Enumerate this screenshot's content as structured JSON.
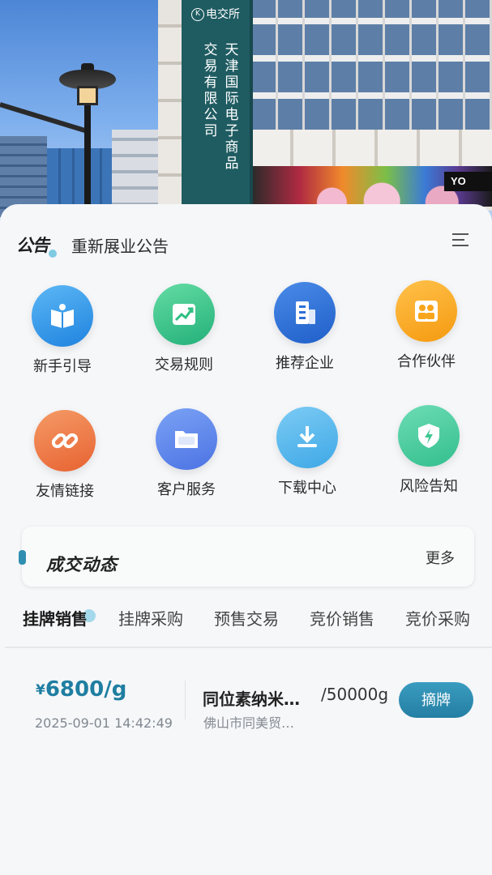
{
  "hero": {
    "sign_logo": "电交所",
    "sign_logo_mark": "K",
    "sign_col_1": "天津国际电子商品",
    "sign_col_2": "交易有限公司",
    "store_badge": "YO"
  },
  "notice": {
    "tag": "公告",
    "text": "重新展业公告",
    "menu_icon": "menu-icon"
  },
  "grid": [
    {
      "label": "新手引导",
      "icon": "book-icon",
      "color": "#2b8fe6"
    },
    {
      "label": "交易规则",
      "icon": "trend-chart-icon",
      "color": "#2fbf82"
    },
    {
      "label": "推荐企业",
      "icon": "building-icon",
      "color": "#2e6fd8"
    },
    {
      "label": "合作伙伴",
      "icon": "partners-icon",
      "color": "#f7a51c"
    },
    {
      "label": "友情链接",
      "icon": "link-icon",
      "color": "#ea6f3c"
    },
    {
      "label": "客户服务",
      "icon": "folder-icon",
      "color": "#5b80e8"
    },
    {
      "label": "下载中心",
      "icon": "download-icon",
      "color": "#4fb2ea"
    },
    {
      "label": "风险告知",
      "icon": "shield-icon",
      "color": "#3fc894"
    }
  ],
  "deals": {
    "title": "成交动态",
    "more": "更多"
  },
  "tabs": [
    "挂牌销售",
    "挂牌采购",
    "预售交易",
    "竞价销售",
    "竞价采购"
  ],
  "active_tab": "挂牌销售",
  "listing": {
    "currency": "¥",
    "price": "6800/g",
    "time": "2025-09-01 14:42:49",
    "product": "同位素纳米…",
    "quantity": "/50000g",
    "seller": "佛山市同美贸…",
    "button": "摘牌"
  },
  "colors": {
    "accent": "#247fa3",
    "price": "#1f7ea1",
    "background": "#f6f7f9"
  }
}
